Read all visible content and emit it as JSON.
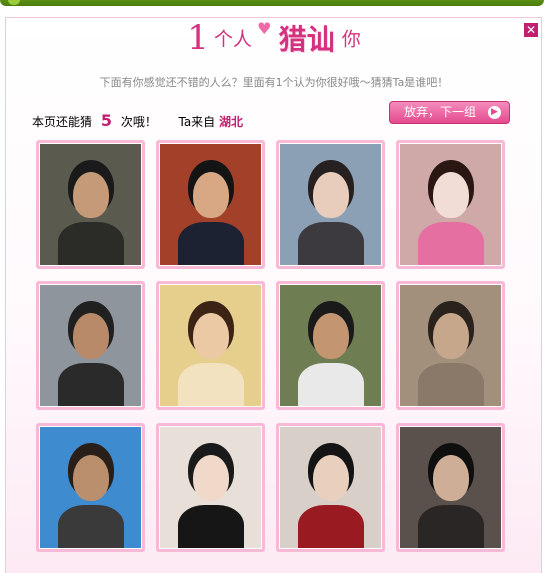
{
  "title": {
    "number": "1",
    "part1": "个人",
    "highlight": "猎讪",
    "part2": "你"
  },
  "subtitle": "下面有你感觉还不错的人么？里面有1个认为你很好哦～猜猜Ta是谁吧！",
  "info": {
    "guess_prefix": "本页还能猜",
    "guess_count": "5",
    "guess_suffix": "次哦！",
    "from_prefix": "Ta来自",
    "location": "湖北"
  },
  "skip_button": {
    "label": "放弃，下一组",
    "icon": "arrow-right-circle-icon"
  },
  "close_icon": "close-icon",
  "photos": [
    {
      "name": "photo-1",
      "bg": "#5a5a4e",
      "skin": "#c59a78",
      "hair": "#1a1a1a",
      "cloth": "#2b2b28"
    },
    {
      "name": "photo-2",
      "bg": "#a2402a",
      "skin": "#d8a784",
      "hair": "#141414",
      "cloth": "#1d2233"
    },
    {
      "name": "photo-3",
      "bg": "#8ba0b4",
      "skin": "#e8cdbd",
      "hair": "#262020",
      "cloth": "#3c3a3e"
    },
    {
      "name": "photo-4",
      "bg": "#cfa8a8",
      "skin": "#f2ddd6",
      "hair": "#2a1713",
      "cloth": "#e66fa2"
    },
    {
      "name": "photo-5",
      "bg": "#8f959d",
      "skin": "#b88a69",
      "hair": "#202020",
      "cloth": "#2a2a2a"
    },
    {
      "name": "photo-6",
      "bg": "#e6cf8d",
      "skin": "#ecc9a5",
      "hair": "#3b2416",
      "cloth": "#f2e2bf"
    },
    {
      "name": "photo-7",
      "bg": "#6e7d52",
      "skin": "#c39570",
      "hair": "#1a1a1a",
      "cloth": "#e9e9e9"
    },
    {
      "name": "photo-8",
      "bg": "#a28f7c",
      "skin": "#c7a78b",
      "hair": "#2a221c",
      "cloth": "#8a7868"
    },
    {
      "name": "photo-9",
      "bg": "#3f8bcf",
      "skin": "#b98f6e",
      "hair": "#2a1f18",
      "cloth": "#3a3a3a"
    },
    {
      "name": "photo-10",
      "bg": "#e8e0d8",
      "skin": "#f0d9c8",
      "hair": "#1a1a1a",
      "cloth": "#161616"
    },
    {
      "name": "photo-11",
      "bg": "#d8d0c8",
      "skin": "#e8cfbe",
      "hair": "#141414",
      "cloth": "#9a1a22"
    },
    {
      "name": "photo-12",
      "bg": "#5a514c",
      "skin": "#cfae97",
      "hair": "#0f0f0f",
      "cloth": "#2a2626"
    }
  ],
  "colors": {
    "accent": "#d4327e",
    "photo_border": "#f7b9d6",
    "button": "#e44a8e",
    "topbar": "#4a7c0c"
  }
}
